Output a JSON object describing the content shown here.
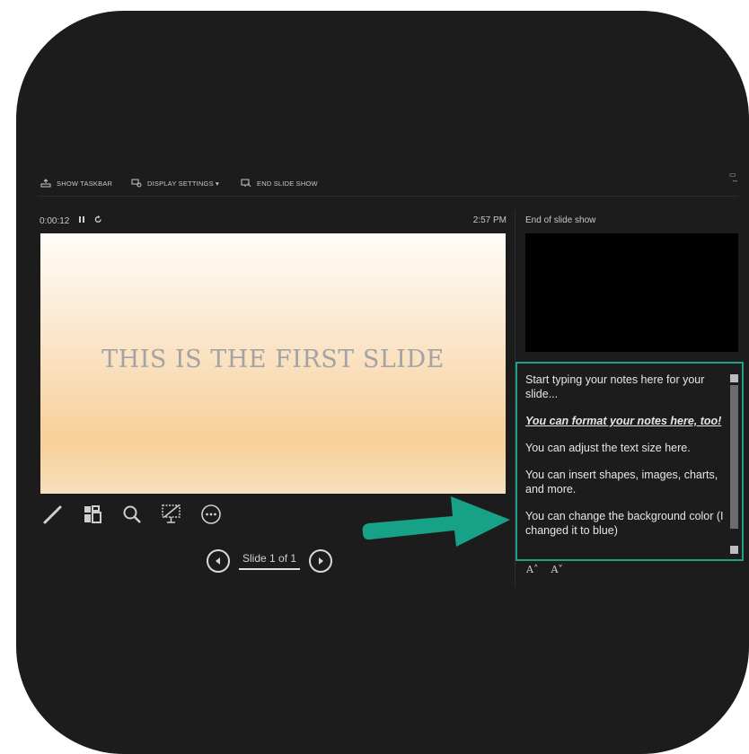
{
  "toolbar": {
    "show_taskbar": "SHOW TASKBAR",
    "display_settings": "DISPLAY SETTINGS ▾",
    "end_slide_show": "END SLIDE SHOW",
    "minimize": "–",
    "restore": "▭"
  },
  "presenter": {
    "elapsed_time": "0:00:12",
    "clock": "2:57 PM",
    "next_title": "End of slide show"
  },
  "slide": {
    "title": "THIS IS THE FIRST SLIDE"
  },
  "tools": [
    "pen-icon",
    "slides-grid-icon",
    "zoom-icon",
    "black-screen-icon",
    "more-options-icon"
  ],
  "navigation": {
    "counter": "Slide 1 of 1"
  },
  "notes": {
    "p1": "Start typing your notes here for your slide...",
    "p2": "You can format your notes here, too!",
    "p3": "You can adjust the text size here.",
    "p4": "You can insert shapes, images, charts, and more.",
    "p5": "You can change the background color (I changed it to blue)",
    "increase_font": "A˄",
    "decrease_font": "A˅"
  },
  "colors": {
    "background": "#1c1c1c",
    "accent": "#1f9f86",
    "arrow": "#17a287"
  }
}
